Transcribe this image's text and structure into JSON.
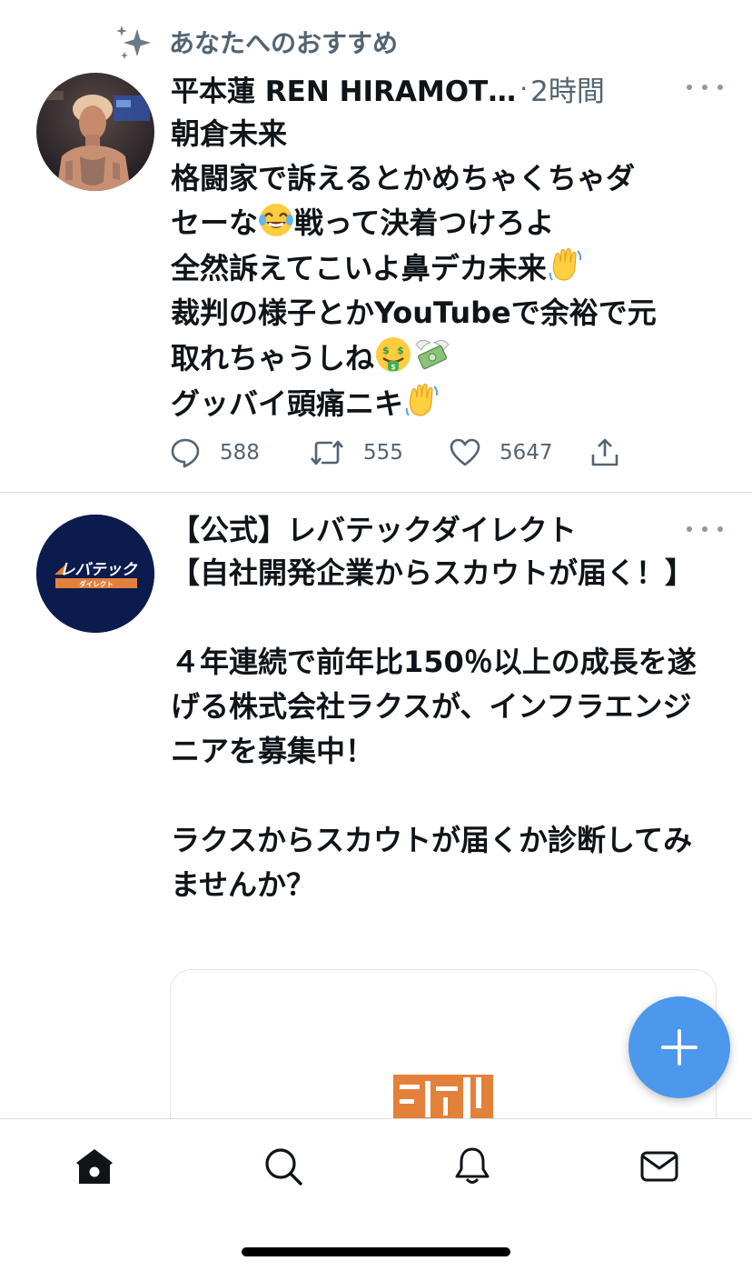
{
  "recommendation": {
    "label": "あなたへのおすすめ"
  },
  "tweets": [
    {
      "author": "平本蓮 REN HIRAMOT…",
      "separator": "·",
      "time": "2時間",
      "lines": {
        "l1": "朝倉未来",
        "l2": "格闘家で訴えるとかめちゃくちゃダ",
        "l3a": "セーな",
        "l3b": "戦って決着つけろよ",
        "l4a": "全然訴えてこいよ鼻デカ未来",
        "l5": "裁判の様子とかYouTubeで余裕で元",
        "l6a": "取れちゃうしね",
        "l7a": "グッバイ頭痛ニキ"
      },
      "emojis": [
        "joy-emoji",
        "waving-hand-emoji",
        "money-mouth-face-emoji",
        "money-with-wings-emoji",
        "waving-hand-emoji"
      ],
      "counts": {
        "replies": "588",
        "retweets": "555",
        "likes": "5647"
      }
    },
    {
      "author": "【公式】レバテックダイレクト",
      "avatar_logo_text": "レバテック",
      "avatar_logo_subtext": "ダイレクト",
      "text": "【自社開発企業からスカウトが届く！】\n\n４年連続で前年比150％以上の成長を遂げる株式会社ラクスが、インフラエンジニアを募集中！\n\nラクスからスカウトが届くか診断してみませんか？"
    }
  ],
  "tabbar": {
    "icons": [
      "home-icon",
      "search-icon",
      "notifications-icon",
      "messages-icon"
    ]
  },
  "colors": {
    "accent": "#4b98ec",
    "secondary_text": "#536471",
    "avatar_navy": "#0b1b4d",
    "brand_orange": "#e3813b"
  }
}
